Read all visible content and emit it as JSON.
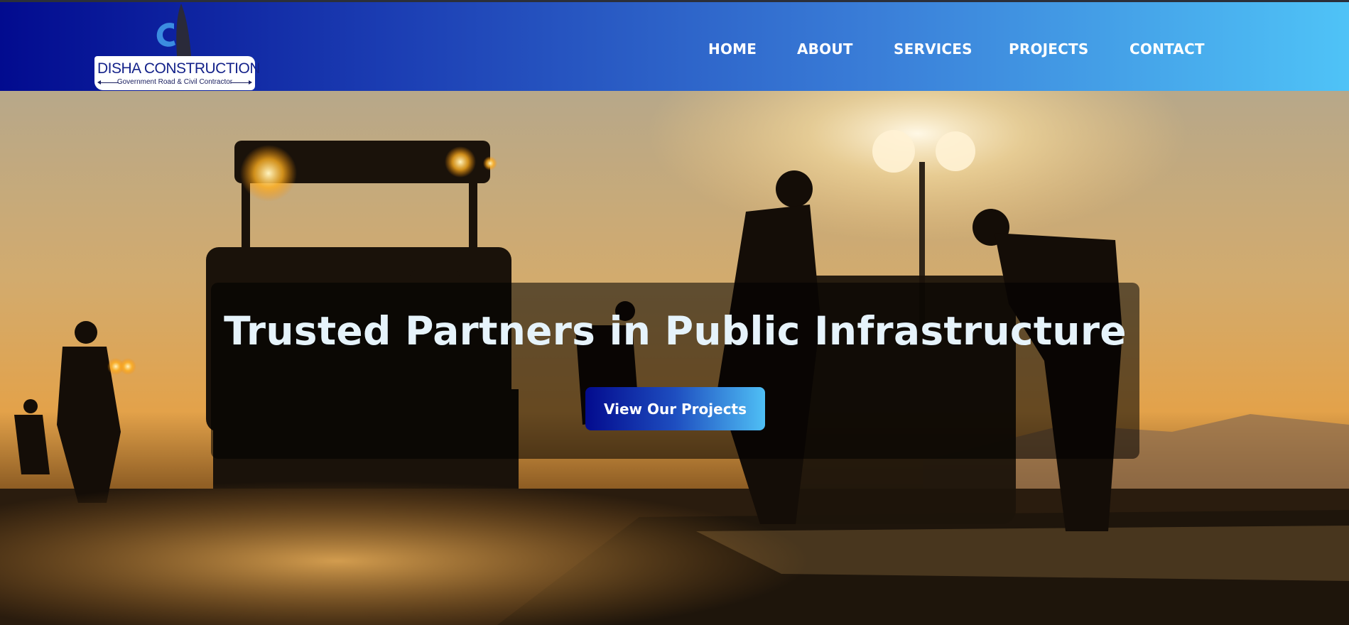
{
  "brand": {
    "name": "DISHA CONSTRUCTION",
    "tagline": "Government Road & Civil Contractor"
  },
  "nav": {
    "items": [
      {
        "label": "HOME"
      },
      {
        "label": "ABOUT"
      },
      {
        "label": "SERVICES"
      },
      {
        "label": "PROJECTS"
      },
      {
        "label": "CONTACT"
      }
    ]
  },
  "hero": {
    "headline": "Trusted Partners in Public Infrastructure",
    "cta_label": "View Our Projects",
    "background_icon": "road-construction-sunset-photo"
  },
  "colors": {
    "header_start": "#020b8f",
    "header_end": "#4fc3f7",
    "headline": "#e6f3fb",
    "cta_start": "#030b8e",
    "cta_end": "#4fbff5"
  }
}
